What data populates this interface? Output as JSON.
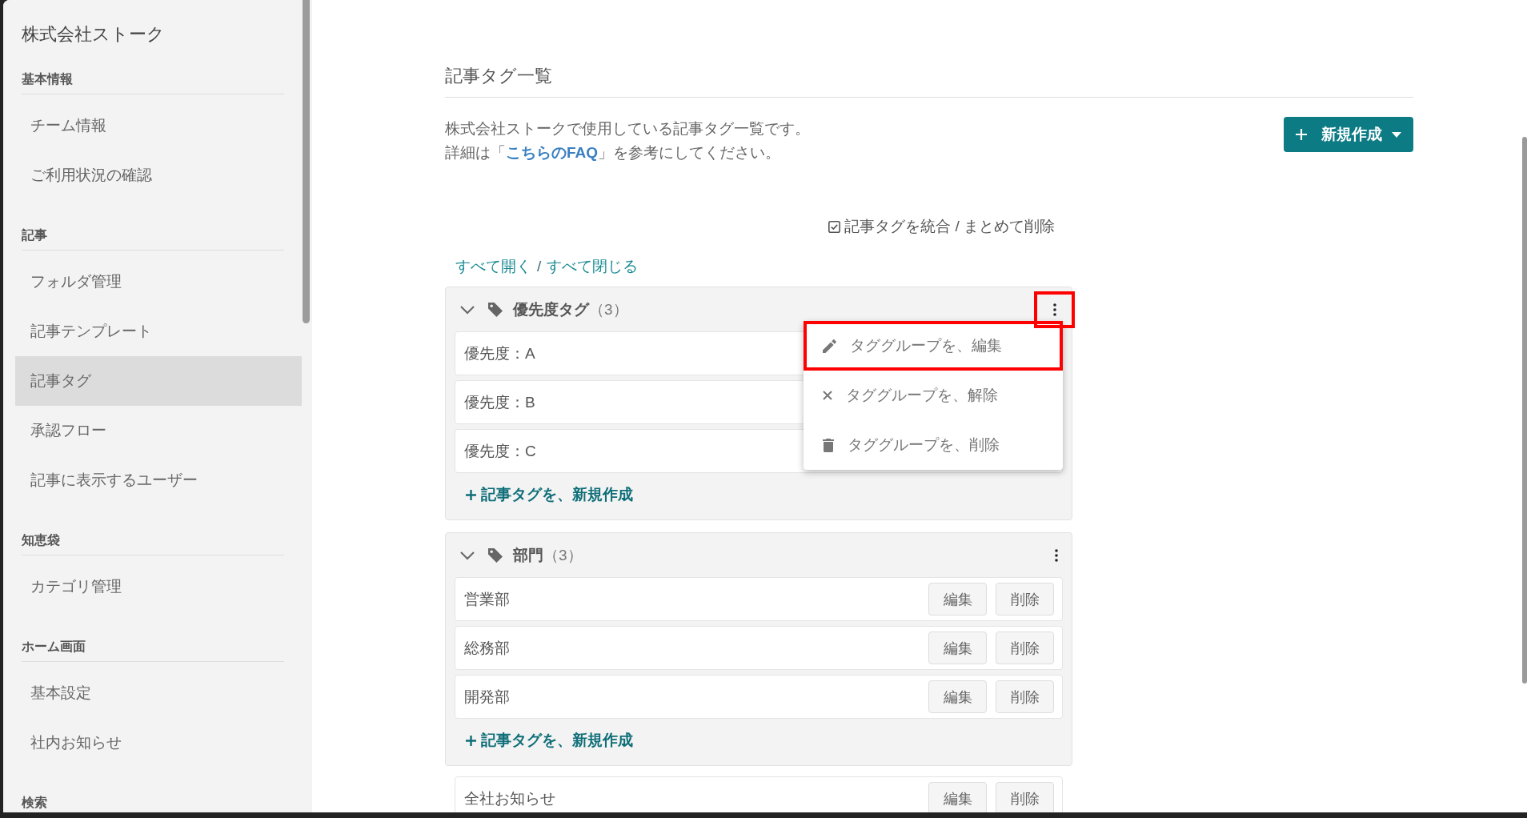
{
  "sidebar": {
    "title": "株式会社ストーク",
    "sections": [
      {
        "heading": "基本情報",
        "items": [
          {
            "label": "チーム情報",
            "selected": false
          },
          {
            "label": "ご利用状況の確認",
            "selected": false
          }
        ]
      },
      {
        "heading": "記事",
        "items": [
          {
            "label": "フォルダ管理",
            "selected": false
          },
          {
            "label": "記事テンプレート",
            "selected": false
          },
          {
            "label": "記事タグ",
            "selected": true
          },
          {
            "label": "承認フロー",
            "selected": false
          },
          {
            "label": "記事に表示するユーザー",
            "selected": false
          }
        ]
      },
      {
        "heading": "知恵袋",
        "items": [
          {
            "label": "カテゴリ管理",
            "selected": false
          }
        ]
      },
      {
        "heading": "ホーム画面",
        "items": [
          {
            "label": "基本設定",
            "selected": false
          },
          {
            "label": "社内お知らせ",
            "selected": false
          }
        ]
      },
      {
        "heading": "検索"
      }
    ]
  },
  "page": {
    "title": "記事タグ一覧",
    "description": "株式会社ストークで使用している記事タグ一覧です。",
    "faq_note": {
      "before": "詳細は「",
      "link": "こちらのFAQ",
      "after": "」を参考にしてください。"
    },
    "create_button": {
      "label": "新規作成"
    },
    "merge_toggle": {
      "label": "記事タグを統合 / まとめて削除"
    },
    "expand_controls": {
      "expand_label": "すべて開く",
      "separator": "/",
      "collapse_label": "すべて閉じる"
    },
    "tag_groups": [
      {
        "name": "優先度タグ",
        "count": "（3）",
        "expanded": true,
        "menu_button_highlighted": true,
        "tags": [
          {
            "name": "優先度：A"
          },
          {
            "name": "優先度：B"
          },
          {
            "name": "優先度：C"
          }
        ],
        "add_link": "記事タグを、新規作成",
        "menu": {
          "items": [
            {
              "kind": "edit",
              "label": "タググループを、編集",
              "highlighted": true
            },
            {
              "kind": "unlink",
              "label": "タググループを、解除",
              "highlighted": false
            },
            {
              "kind": "delete",
              "label": "タググループを、削除",
              "highlighted": false
            }
          ]
        }
      },
      {
        "name": "部門",
        "count": "（3）",
        "expanded": true,
        "menu_button_highlighted": false,
        "tags": [
          {
            "name": "営業部",
            "actions": [
              "編集",
              "削除"
            ]
          },
          {
            "name": "総務部",
            "actions": [
              "編集",
              "削除"
            ]
          },
          {
            "name": "開発部",
            "actions": [
              "編集",
              "削除"
            ]
          }
        ],
        "add_link": "記事タグを、新規作成"
      }
    ],
    "ungrouped_tags": [
      {
        "name": "全社お知らせ",
        "actions": [
          "編集",
          "削除"
        ]
      }
    ]
  }
}
